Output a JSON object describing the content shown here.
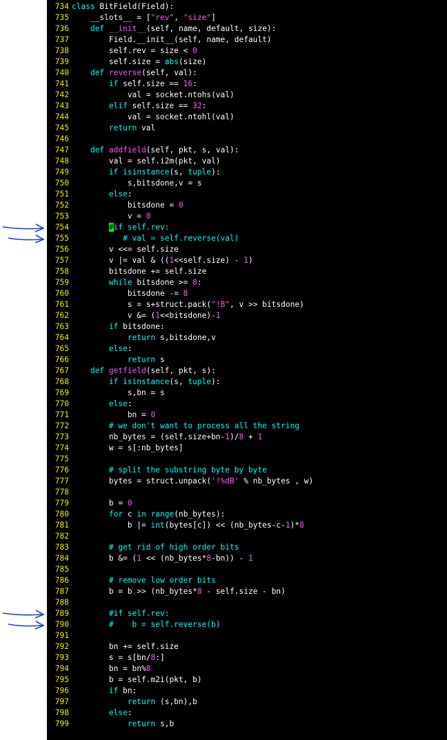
{
  "editor": {
    "lines": [
      {
        "n": "734",
        "tokens": [
          [
            "kw",
            "class"
          ],
          [
            "plain",
            " BitField(Field):"
          ]
        ]
      },
      {
        "n": "735",
        "tokens": [
          [
            "plain",
            "    __slots__ = ["
          ],
          [
            "str",
            "\"rev\""
          ],
          [
            "plain",
            ", "
          ],
          [
            "str",
            "\"size\""
          ],
          [
            "plain",
            "]"
          ]
        ]
      },
      {
        "n": "736",
        "tokens": [
          [
            "plain",
            "    "
          ],
          [
            "kw",
            "def"
          ],
          [
            "plain",
            " "
          ],
          [
            "fn",
            "__init__"
          ],
          [
            "plain",
            "(self, name, default, size):"
          ]
        ]
      },
      {
        "n": "737",
        "tokens": [
          [
            "plain",
            "        Field.__init__(self, name, default)"
          ]
        ]
      },
      {
        "n": "738",
        "tokens": [
          [
            "plain",
            "        self.rev = size < "
          ],
          [
            "num",
            "0"
          ]
        ]
      },
      {
        "n": "739",
        "tokens": [
          [
            "plain",
            "        self.size = "
          ],
          [
            "bi",
            "abs"
          ],
          [
            "plain",
            "(size)"
          ]
        ]
      },
      {
        "n": "740",
        "tokens": [
          [
            "plain",
            "    "
          ],
          [
            "kw",
            "def"
          ],
          [
            "plain",
            " "
          ],
          [
            "fn",
            "reverse"
          ],
          [
            "plain",
            "(self, val):"
          ]
        ]
      },
      {
        "n": "741",
        "tokens": [
          [
            "plain",
            "        "
          ],
          [
            "kw",
            "if"
          ],
          [
            "plain",
            " self.size == "
          ],
          [
            "num",
            "16"
          ],
          [
            "plain",
            ":"
          ]
        ]
      },
      {
        "n": "742",
        "tokens": [
          [
            "plain",
            "            val = socket.ntohs(val)"
          ]
        ]
      },
      {
        "n": "743",
        "tokens": [
          [
            "plain",
            "        "
          ],
          [
            "kw",
            "elif"
          ],
          [
            "plain",
            " self.size == "
          ],
          [
            "num",
            "32"
          ],
          [
            "plain",
            ":"
          ]
        ]
      },
      {
        "n": "744",
        "tokens": [
          [
            "plain",
            "            val = socket.ntohl(val)"
          ]
        ]
      },
      {
        "n": "745",
        "tokens": [
          [
            "plain",
            "        "
          ],
          [
            "kw",
            "return"
          ],
          [
            "plain",
            " val"
          ]
        ]
      },
      {
        "n": "746",
        "tokens": []
      },
      {
        "n": "747",
        "tokens": [
          [
            "plain",
            "    "
          ],
          [
            "kw",
            "def"
          ],
          [
            "plain",
            " "
          ],
          [
            "fn",
            "addfield"
          ],
          [
            "plain",
            "(self, pkt, s, val):"
          ]
        ]
      },
      {
        "n": "748",
        "tokens": [
          [
            "plain",
            "        val = self.i2m(pkt, val)"
          ]
        ]
      },
      {
        "n": "749",
        "tokens": [
          [
            "plain",
            "        "
          ],
          [
            "kw",
            "if"
          ],
          [
            "plain",
            " "
          ],
          [
            "bi",
            "isinstance"
          ],
          [
            "plain",
            "(s, "
          ],
          [
            "bi",
            "tuple"
          ],
          [
            "plain",
            "):"
          ]
        ]
      },
      {
        "n": "750",
        "tokens": [
          [
            "plain",
            "            s,bitsdone,v = s"
          ]
        ]
      },
      {
        "n": "751",
        "tokens": [
          [
            "plain",
            "        "
          ],
          [
            "kw",
            "else"
          ],
          [
            "plain",
            ":"
          ]
        ]
      },
      {
        "n": "752",
        "tokens": [
          [
            "plain",
            "            bitsdone = "
          ],
          [
            "num",
            "0"
          ]
        ]
      },
      {
        "n": "753",
        "tokens": [
          [
            "plain",
            "            v = "
          ],
          [
            "num",
            "0"
          ]
        ]
      },
      {
        "n": "754",
        "tokens": [
          [
            "plain",
            "        "
          ],
          [
            "cursor",
            "#"
          ],
          [
            "cm",
            "if self.rev:"
          ]
        ]
      },
      {
        "n": "755",
        "tokens": [
          [
            "cm",
            "           # val = self.reverse(val)"
          ]
        ]
      },
      {
        "n": "756",
        "tokens": [
          [
            "plain",
            "        v <<= self.size"
          ]
        ]
      },
      {
        "n": "757",
        "tokens": [
          [
            "plain",
            "        v |= val & (("
          ],
          [
            "num",
            "1"
          ],
          [
            "plain",
            "<<self.size) - "
          ],
          [
            "num",
            "1"
          ],
          [
            "plain",
            ")"
          ]
        ]
      },
      {
        "n": "758",
        "tokens": [
          [
            "plain",
            "        bitsdone += self.size"
          ]
        ]
      },
      {
        "n": "759",
        "tokens": [
          [
            "plain",
            "        "
          ],
          [
            "kw",
            "while"
          ],
          [
            "plain",
            " bitsdone >= "
          ],
          [
            "num",
            "8"
          ],
          [
            "plain",
            ":"
          ]
        ]
      },
      {
        "n": "760",
        "tokens": [
          [
            "plain",
            "            bitsdone -= "
          ],
          [
            "num",
            "8"
          ]
        ]
      },
      {
        "n": "761",
        "tokens": [
          [
            "plain",
            "            s = s+struct.pack("
          ],
          [
            "str",
            "\"!B\""
          ],
          [
            "plain",
            ", v >> bitsdone)"
          ]
        ]
      },
      {
        "n": "762",
        "tokens": [
          [
            "plain",
            "            v &= ("
          ],
          [
            "num",
            "1"
          ],
          [
            "plain",
            "<<bitsdone)-"
          ],
          [
            "num",
            "1"
          ]
        ]
      },
      {
        "n": "763",
        "tokens": [
          [
            "plain",
            "        "
          ],
          [
            "kw",
            "if"
          ],
          [
            "plain",
            " bitsdone:"
          ]
        ]
      },
      {
        "n": "764",
        "tokens": [
          [
            "plain",
            "            "
          ],
          [
            "kw",
            "return"
          ],
          [
            "plain",
            " s,bitsdone,v"
          ]
        ]
      },
      {
        "n": "765",
        "tokens": [
          [
            "plain",
            "        "
          ],
          [
            "kw",
            "else"
          ],
          [
            "plain",
            ":"
          ]
        ]
      },
      {
        "n": "766",
        "tokens": [
          [
            "plain",
            "            "
          ],
          [
            "kw",
            "return"
          ],
          [
            "plain",
            " s"
          ]
        ]
      },
      {
        "n": "767",
        "tokens": [
          [
            "plain",
            "    "
          ],
          [
            "kw",
            "def"
          ],
          [
            "plain",
            " "
          ],
          [
            "fn",
            "getfield"
          ],
          [
            "plain",
            "(self, pkt, s):"
          ]
        ]
      },
      {
        "n": "768",
        "tokens": [
          [
            "plain",
            "        "
          ],
          [
            "kw",
            "if"
          ],
          [
            "plain",
            " "
          ],
          [
            "bi",
            "isinstance"
          ],
          [
            "plain",
            "(s, "
          ],
          [
            "bi",
            "tuple"
          ],
          [
            "plain",
            "):"
          ]
        ]
      },
      {
        "n": "769",
        "tokens": [
          [
            "plain",
            "            s,bn = s"
          ]
        ]
      },
      {
        "n": "770",
        "tokens": [
          [
            "plain",
            "        "
          ],
          [
            "kw",
            "else"
          ],
          [
            "plain",
            ":"
          ]
        ]
      },
      {
        "n": "771",
        "tokens": [
          [
            "plain",
            "            bn = "
          ],
          [
            "num",
            "0"
          ]
        ]
      },
      {
        "n": "772",
        "tokens": [
          [
            "cm",
            "        # we don't want to process all the string"
          ]
        ]
      },
      {
        "n": "773",
        "tokens": [
          [
            "plain",
            "        nb_bytes = (self.size+bn-"
          ],
          [
            "num",
            "1"
          ],
          [
            "plain",
            ")/"
          ],
          [
            "num",
            "8"
          ],
          [
            "plain",
            " + "
          ],
          [
            "num",
            "1"
          ]
        ]
      },
      {
        "n": "774",
        "tokens": [
          [
            "plain",
            "        w = s[:nb_bytes]"
          ]
        ]
      },
      {
        "n": "775",
        "tokens": []
      },
      {
        "n": "776",
        "tokens": [
          [
            "cm",
            "        # split the substring byte by byte"
          ]
        ]
      },
      {
        "n": "777",
        "tokens": [
          [
            "plain",
            "        bytes = struct.unpack("
          ],
          [
            "str",
            "'!%dB'"
          ],
          [
            "plain",
            " % nb_bytes , w)"
          ]
        ]
      },
      {
        "n": "778",
        "tokens": []
      },
      {
        "n": "779",
        "tokens": [
          [
            "plain",
            "        b = "
          ],
          [
            "num",
            "0"
          ]
        ]
      },
      {
        "n": "780",
        "tokens": [
          [
            "plain",
            "        "
          ],
          [
            "kw",
            "for"
          ],
          [
            "plain",
            " c "
          ],
          [
            "kw",
            "in"
          ],
          [
            "plain",
            " "
          ],
          [
            "bi",
            "range"
          ],
          [
            "plain",
            "(nb_bytes):"
          ]
        ]
      },
      {
        "n": "781",
        "tokens": [
          [
            "plain",
            "            b |= "
          ],
          [
            "bi",
            "int"
          ],
          [
            "plain",
            "(bytes[c]) << (nb_bytes-c-"
          ],
          [
            "num",
            "1"
          ],
          [
            "plain",
            ")*"
          ],
          [
            "num",
            "8"
          ]
        ]
      },
      {
        "n": "782",
        "tokens": []
      },
      {
        "n": "783",
        "tokens": [
          [
            "cm",
            "        # get rid of high order bits"
          ]
        ]
      },
      {
        "n": "784",
        "tokens": [
          [
            "plain",
            "        b &= ("
          ],
          [
            "num",
            "1"
          ],
          [
            "plain",
            " << (nb_bytes*"
          ],
          [
            "num",
            "8"
          ],
          [
            "plain",
            "-bn)) - "
          ],
          [
            "num",
            "1"
          ]
        ]
      },
      {
        "n": "785",
        "tokens": []
      },
      {
        "n": "786",
        "tokens": [
          [
            "cm",
            "        # remove low order bits"
          ]
        ]
      },
      {
        "n": "787",
        "tokens": [
          [
            "plain",
            "        b = b >> (nb_bytes*"
          ],
          [
            "num",
            "8"
          ],
          [
            "plain",
            " - self.size - bn)"
          ]
        ]
      },
      {
        "n": "788",
        "tokens": []
      },
      {
        "n": "789",
        "tokens": [
          [
            "cm",
            "        #if self.rev:"
          ]
        ]
      },
      {
        "n": "790",
        "tokens": [
          [
            "cm",
            "        #    b = self.reverse(b)"
          ]
        ]
      },
      {
        "n": "791",
        "tokens": []
      },
      {
        "n": "792",
        "tokens": [
          [
            "plain",
            "        bn += self.size"
          ]
        ]
      },
      {
        "n": "793",
        "tokens": [
          [
            "plain",
            "        s = s[bn/"
          ],
          [
            "num",
            "8"
          ],
          [
            "plain",
            ":]"
          ]
        ]
      },
      {
        "n": "794",
        "tokens": [
          [
            "plain",
            "        bn = bn%"
          ],
          [
            "num",
            "8"
          ]
        ]
      },
      {
        "n": "795",
        "tokens": [
          [
            "plain",
            "        b = self.m2i(pkt, b)"
          ]
        ]
      },
      {
        "n": "796",
        "tokens": [
          [
            "plain",
            "        "
          ],
          [
            "kw",
            "if"
          ],
          [
            "plain",
            " bn:"
          ]
        ]
      },
      {
        "n": "797",
        "tokens": [
          [
            "plain",
            "            "
          ],
          [
            "kw",
            "return"
          ],
          [
            "plain",
            " (s,bn),b"
          ]
        ]
      },
      {
        "n": "798",
        "tokens": [
          [
            "plain",
            "        "
          ],
          [
            "kw",
            "else"
          ],
          [
            "plain",
            ":"
          ]
        ]
      },
      {
        "n": "799",
        "tokens": [
          [
            "plain",
            "            "
          ],
          [
            "kw",
            "return"
          ],
          [
            "plain",
            " s,b"
          ]
        ]
      }
    ]
  },
  "annotations": {
    "marked_lines": [
      "754",
      "755",
      "789",
      "790"
    ],
    "arrow_color": "#1a3fd6"
  },
  "colors": {
    "background": "#000000",
    "line_number": "#f0f000",
    "keyword": "#00ffff",
    "string_number": "#ff55ff",
    "comment": "#00ffff",
    "cursor": "#00ff00"
  }
}
